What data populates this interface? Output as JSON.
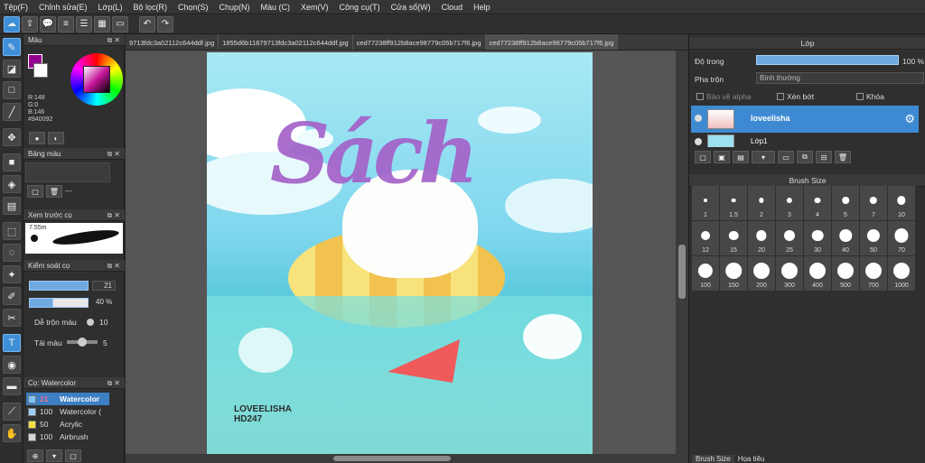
{
  "menu": [
    "Tệp(F)",
    "Chỉnh sửa(E)",
    "Lớp(L)",
    "Bộ lọc(R)",
    "Chọn(S)",
    "Chụp(N)",
    "Màu (C)",
    "Xem(V)",
    "Công cụ(T)",
    "Cửa sổ(W)",
    "Cloud",
    "Help"
  ],
  "tabs": [
    "9713fdc3a02112c644ddf.jpg",
    "1855d6b11879713fdc3a02112c644ddf.jpg",
    "ced77238ff912b8ace98779c05b717f6.jpg",
    "ced77238ff912b8ace98779c05b717f6.jpg"
  ],
  "left": {
    "color_title": "Màu",
    "rgb": {
      "r": "R:148",
      "g": "G:0",
      "b": "B:146",
      "hex": "#940092"
    },
    "palette_title": "Bảng màu",
    "palette_text": "---",
    "preview_title": "Xem trước cọ",
    "preview_size": "7.55m",
    "control_title": "Kiểm soát cọ",
    "size_val": "21",
    "opacity_val": "40 %",
    "mix_label": "Dễ trộn màu",
    "mix_val": "10",
    "reload_label": "Tải màu",
    "reload_val": "5",
    "brush_title": "Cọ: Watercolor",
    "brushes": [
      {
        "size": "21",
        "name": "Watercolor",
        "color": "#7fc3f7",
        "selected": true
      },
      {
        "size": "100",
        "name": "Watercolor (",
        "color": "#9ad0f7",
        "selected": false
      },
      {
        "size": "50",
        "name": "Acrylic",
        "color": "#f3e046",
        "selected": false
      },
      {
        "size": "100",
        "name": "Airbrush",
        "color": "#d6d6d6",
        "selected": false
      }
    ]
  },
  "canvas": {
    "title_art": "Sách",
    "logo_line1": "LOVEELISHA",
    "logo_line2": "HD247"
  },
  "right": {
    "layer_title": "Lớp",
    "opacity_label": "Độ trong",
    "opacity_value": "100 %",
    "opacity_fraction": 1.0,
    "blend_label": "Pha trộn",
    "blend_value": "Bình thường",
    "protect_alpha": "Bảo vệ alpha",
    "clipping": "Xén bớt",
    "lock": "Khóa",
    "layers": [
      {
        "name": "loveelisha",
        "selected": true
      },
      {
        "name": "Lớp1",
        "selected": false
      }
    ],
    "brushsize_title": "Brush Size",
    "brush_sizes": [
      "1",
      "1.5",
      "2",
      "3",
      "4",
      "5",
      "7",
      "10",
      "12",
      "15",
      "20",
      "25",
      "30",
      "40",
      "50",
      "70",
      "100",
      "150",
      "200",
      "300",
      "400",
      "500",
      "700",
      "1000"
    ],
    "bottom_tabs": [
      "Brush Size",
      "Họa tiêu"
    ]
  }
}
